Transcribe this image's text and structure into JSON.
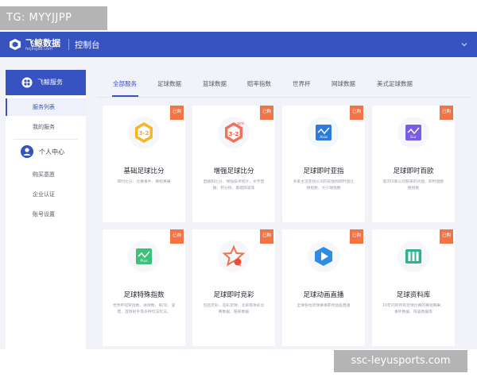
{
  "tag": "TG: MYYJJPP",
  "watermark": "ssc-leyusports.com",
  "header": {
    "logo_title": "飞鲸数据",
    "logo_sub": "feijing88.com",
    "title": "控制台",
    "chevron_icon": "chevron-down-icon"
  },
  "colors": {
    "brand": "#3653c0",
    "ribbon": "#f07446",
    "background": "#f1f3f8"
  },
  "sidebar": {
    "head_label": "飞鲸服务",
    "items_top": [
      "服务列表",
      "我的服务"
    ],
    "group_label": "个人中心",
    "items_bottom": [
      "购买意愿",
      "企业认证",
      "账号设置"
    ]
  },
  "tabs": [
    "全部服务",
    "足球数据",
    "篮球数据",
    "赔率指数",
    "世界杯",
    "网球数据",
    "美式足球数据"
  ],
  "cards": [
    {
      "badge": "已购",
      "title": "基础足球比分",
      "desc": "即时比分、比赛事件、赛程赛果",
      "icon": "hexagon-3-2-icon"
    },
    {
      "badge": "已购",
      "title": "增强足球比分",
      "desc": "直播和比分、增强技术统计、文字直播、积分榜、基础阵容等",
      "icon": "hexagon-pro-3-2-icon"
    },
    {
      "badge": "已购",
      "title": "足球即时亚指",
      "desc": "多家主流亚指公司的初盘和即时盘让球指数、大小球指数",
      "icon": "chart-asia-icon"
    },
    {
      "badge": "已购",
      "title": "足球即时百欧",
      "desc": "超350家公司赔率的初盘、即时盘欧赔指数",
      "icon": "chart-eur-icon"
    },
    {
      "badge": "已购",
      "title": "足球特殊指数",
      "desc": "世界杯冠军指数、进球数、单/双、波胆、首球射手等多种玩法玩法。",
      "icon": "chart-plus-icon"
    },
    {
      "badge": "已购",
      "title": "足球即时竞彩",
      "desc": "包括足彩、竞彩足球、北单等体彩比赛数据、赔率数据",
      "icon": "star-ball-icon"
    },
    {
      "badge": "已购",
      "title": "足球动画直播",
      "desc": "全球各地足球赛事即时动画直播",
      "icon": "play-animation-icon"
    },
    {
      "badge": "已购",
      "title": "足球资料库",
      "desc": "10年内的所有足球比赛的赛程赛果、事件数据、阵容数据等",
      "icon": "database-icon"
    }
  ]
}
